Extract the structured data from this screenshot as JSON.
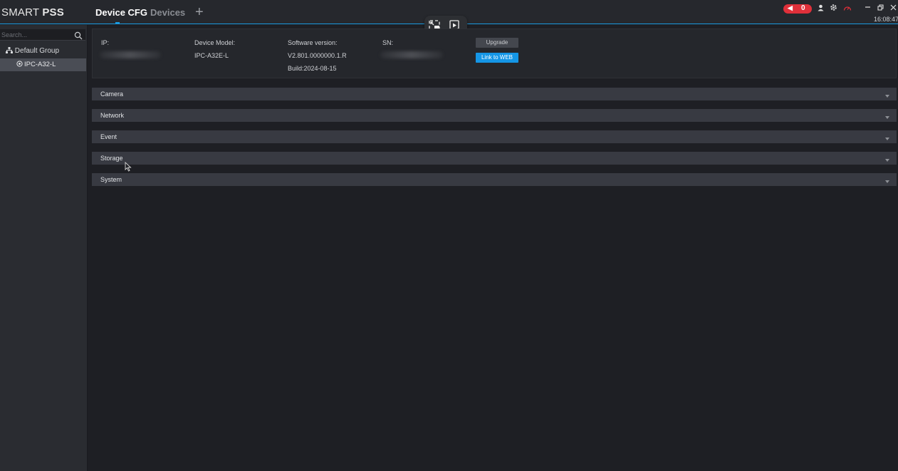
{
  "app": {
    "logo_light": "SMART ",
    "logo_bold": "PSS",
    "tabs": [
      {
        "label": "Device CFG",
        "active": true
      },
      {
        "label": "Devices",
        "active": false
      }
    ],
    "add_tab_symbol": "+",
    "alarm_count": "0",
    "clock": "16:08:47"
  },
  "sidebar": {
    "search_placeholder": "Search...",
    "group_label": "Default Group",
    "device_label": "IPC-A32-L"
  },
  "device_info": {
    "ip_label": "IP:",
    "model_label": "Device Model:",
    "model_value": "IPC-A32E-L",
    "software_label": "Software version:",
    "software_value": "V2.801.0000000.1.R",
    "build_value": "Build:2024-08-15",
    "sn_label": "SN:",
    "upgrade_label": "Upgrade",
    "web_label": "Link to WEB"
  },
  "sections": [
    {
      "label": "Camera"
    },
    {
      "label": "Network"
    },
    {
      "label": "Event"
    },
    {
      "label": "Storage"
    },
    {
      "label": "System"
    }
  ],
  "colors": {
    "accent": "#1a9be0",
    "alarm": "#e0303a",
    "section_bar": "#383a42",
    "background": "#1e1f24"
  }
}
